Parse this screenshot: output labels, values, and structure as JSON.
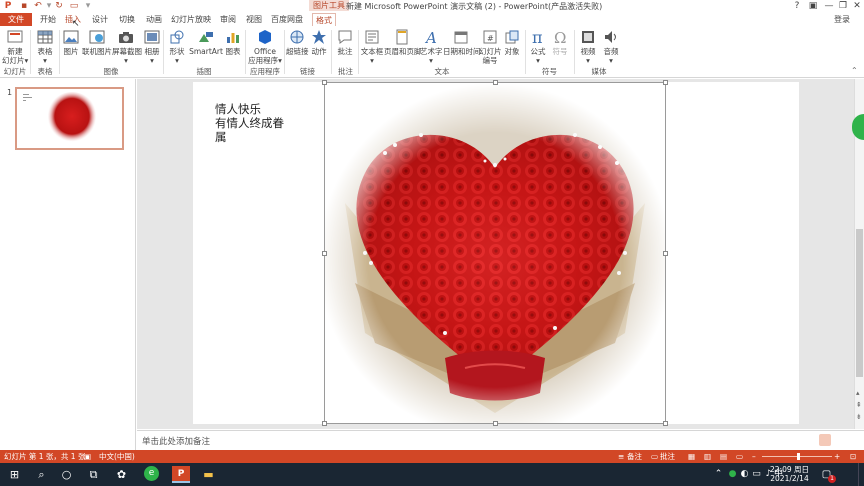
{
  "window": {
    "title": "新建 Microsoft PowerPoint 演示文稿 (2) - PowerPoint(产品激活失败)",
    "context_tab_group": "图片工具",
    "login": "登录",
    "controls": [
      "?",
      "▣",
      "—",
      "❐",
      "✕"
    ]
  },
  "tabs": [
    "文件",
    "开始",
    "插入",
    "设计",
    "切换",
    "动画",
    "幻灯片放映",
    "审阅",
    "视图",
    "百度网盘",
    "格式"
  ],
  "active_tab": "插入",
  "ribbon": {
    "buttons": {
      "new_slide": [
        "新建",
        "幻灯片▾"
      ],
      "table": [
        "表格",
        "▾"
      ],
      "picture": "图片",
      "online_picture": "联机图片",
      "screenshot": [
        "屏幕截图",
        "▾"
      ],
      "album": [
        "相册",
        "▾"
      ],
      "shapes": [
        "形状",
        "▾"
      ],
      "smartart": "SmartArt",
      "chart": "图表",
      "office_apps": [
        "Office",
        "应用程序▾"
      ],
      "hyperlink": "超链接",
      "action": "动作",
      "comment": "批注",
      "textbox": [
        "文本框",
        "▾"
      ],
      "header_footer": "页眉和页脚",
      "wordart": [
        "艺术字",
        "▾"
      ],
      "datetime": "日期和时间",
      "slide_number": [
        "幻灯片",
        "编号"
      ],
      "object": "对象",
      "equation": [
        "公式",
        "▾"
      ],
      "symbol": "符号",
      "video": [
        "视频",
        "▾"
      ],
      "audio": [
        "音频",
        "▾"
      ]
    },
    "groups": {
      "slides": "幻灯片",
      "tables": "表格",
      "images": "图像",
      "illustrations": "插图",
      "apps": "应用程序",
      "links": "链接",
      "comments": "批注",
      "text": "文本",
      "symbols": "符号",
      "media": "媒体"
    }
  },
  "thumbnails": {
    "slide_number": "1"
  },
  "slide": {
    "text_lines": [
      "情人快乐",
      "有情人终成眷",
      "属"
    ]
  },
  "notes": {
    "placeholder": "单击此处添加备注"
  },
  "status": {
    "slide_info": "幻灯片 第 1 张，共 1 张",
    "language": "中文(中国)",
    "notes_btn": "备注",
    "comments_btn": "批注"
  },
  "taskbar": {
    "time": "22:09 周日",
    "date": "2021/2/14",
    "ime": "中",
    "notification_count": "1"
  },
  "colors": {
    "accent": "#d24726",
    "rose": "#d81e1e",
    "taskbar": "#1a2633"
  }
}
